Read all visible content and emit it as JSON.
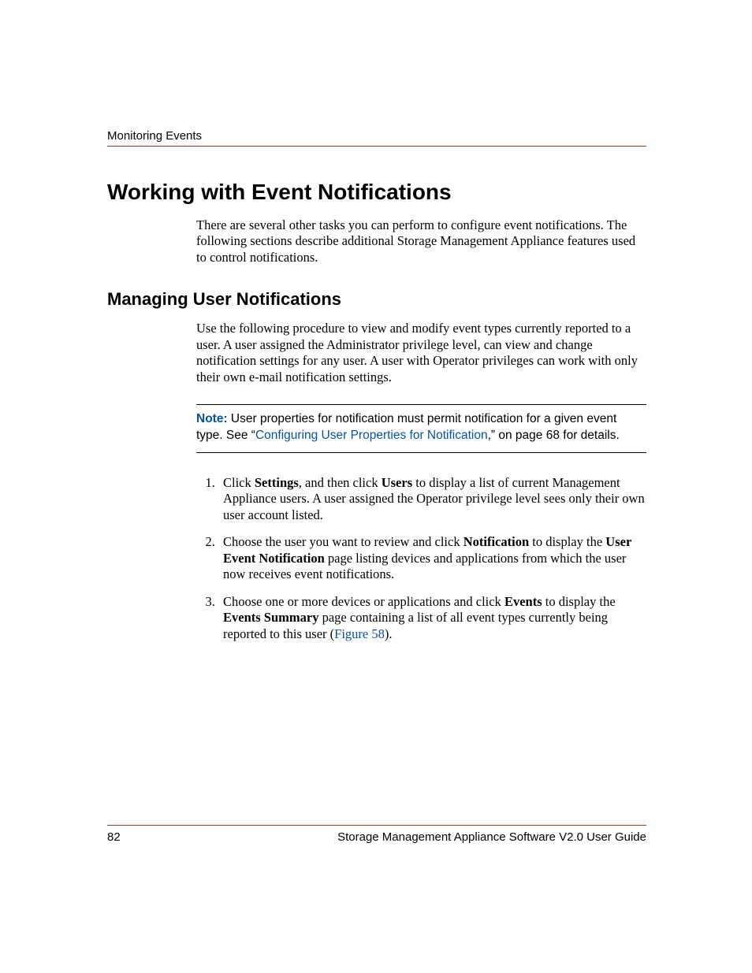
{
  "header": {
    "running": "Monitoring Events"
  },
  "main": {
    "h1": "Working with Event Notifications",
    "intro": "There are several other tasks you can perform to configure event notifications. The following sections describe additional Storage Management Appliance features used to control notifications.",
    "h2": "Managing User Notifications",
    "para2": "Use the following procedure to view and modify event types currently reported to a user. A user assigned the Administrator privilege level, can view and change notification settings for any user. A user with Operator privileges can work with only their own e-mail notification settings.",
    "note": {
      "label": "Note:",
      "before_link": "User properties for notification must permit notification for a given event type. See “",
      "link": "Configuring User Properties for Notification",
      "after_link": ",” on page 68 for details."
    },
    "steps": {
      "s1": {
        "t1": "Click ",
        "b1": "Settings",
        "t2": ", and then click ",
        "b2": "Users",
        "t3": " to display a list of current Management Appliance users. A user assigned the Operator privilege level sees only their own user account listed."
      },
      "s2": {
        "t1": "Choose the user you want to review and click ",
        "b1": "Notification",
        "t2": " to display the ",
        "b2": "User Event Notification",
        "t3": " page listing devices and applications from which the user now receives event notifications."
      },
      "s3": {
        "t1": "Choose one or more devices or applications and click ",
        "b1": "Events",
        "t2": " to display the ",
        "b2": "Events Summary",
        "t3": " page containing a list of all event types currently being reported to this user (",
        "link": "Figure 58",
        "t4": ")."
      }
    }
  },
  "footer": {
    "page": "82",
    "title": "Storage Management Appliance Software V2.0 User Guide"
  }
}
